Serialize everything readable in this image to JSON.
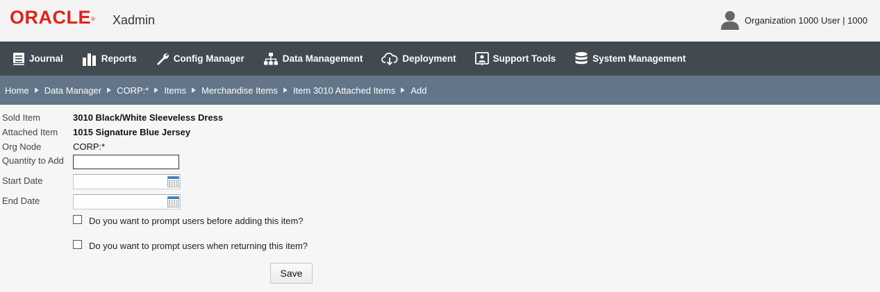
{
  "header": {
    "logo": "ORACLE",
    "app_name": "Xadmin",
    "user_label": "Organization 1000 User | 1000"
  },
  "nav": {
    "items": [
      {
        "label": "Journal",
        "icon": "journal-icon"
      },
      {
        "label": "Reports",
        "icon": "bar-chart-icon"
      },
      {
        "label": "Config Manager",
        "icon": "wrench-icon"
      },
      {
        "label": "Data Management",
        "icon": "hierarchy-icon"
      },
      {
        "label": "Deployment",
        "icon": "cloud-download-icon"
      },
      {
        "label": "Support Tools",
        "icon": "support-icon"
      },
      {
        "label": "System Management",
        "icon": "database-icon"
      }
    ]
  },
  "breadcrumb": {
    "items": [
      "Home",
      "Data Manager",
      "CORP:*",
      "Items",
      "Merchandise Items",
      "Item 3010 Attached Items"
    ],
    "current": "Add"
  },
  "form": {
    "sold_item": {
      "label": "Sold Item",
      "value": "3010 Black/White Sleeveless Dress"
    },
    "attached_item": {
      "label": "Attached Item",
      "value": "1015 Signature Blue Jersey"
    },
    "org_node": {
      "label": "Org Node",
      "value": "CORP:*"
    },
    "quantity": {
      "label": "Quantity to Add",
      "value": ""
    },
    "start_date": {
      "label": "Start Date",
      "value": ""
    },
    "end_date": {
      "label": "End Date",
      "value": ""
    },
    "prompt_adding": {
      "label": "Do you want to prompt users before adding this item?",
      "checked": false
    },
    "prompt_returning": {
      "label": "Do you want to prompt users when returning this item?",
      "checked": false
    },
    "save_label": "Save"
  },
  "colors": {
    "brand": "#e2231a",
    "navbar": "#414a51",
    "breadcrumb": "#627589"
  }
}
